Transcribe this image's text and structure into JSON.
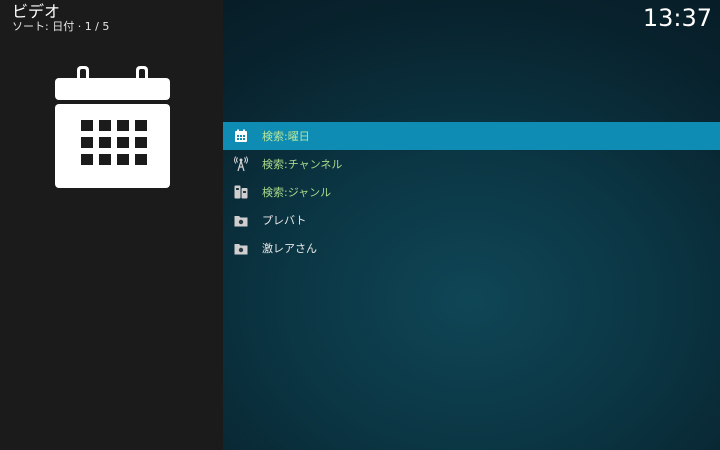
{
  "header": {
    "title": "ビデオ",
    "sort": "ソート: 日付 · 1 / 5"
  },
  "clock": "13:37",
  "menu": {
    "items": [
      {
        "label": "検索:曜日",
        "icon": "calendar-icon",
        "type": "search"
      },
      {
        "label": "検索:チャンネル",
        "icon": "antenna-icon",
        "type": "search"
      },
      {
        "label": "検索:ジャンル",
        "icon": "genre-icon",
        "type": "search"
      },
      {
        "label": "プレバト",
        "icon": "folder-icon",
        "type": "plain"
      },
      {
        "label": "激レアさん",
        "icon": "folder-icon",
        "type": "plain"
      }
    ],
    "selected_index": 0
  },
  "colors": {
    "selection": "#0e8cb4",
    "search_label": "#a9d98b",
    "left_panel": "#1b1b1b"
  }
}
